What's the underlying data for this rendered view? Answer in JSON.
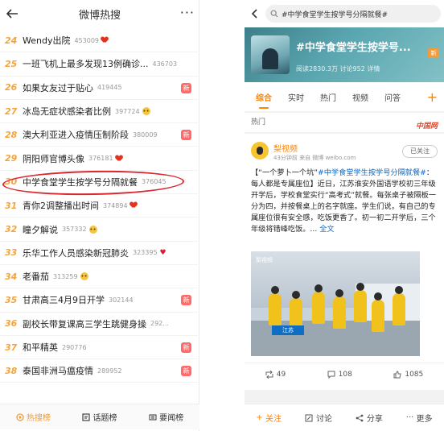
{
  "left": {
    "title": "微博热搜",
    "more_label": "···",
    "rows": [
      {
        "rank": "24",
        "text": "Wendy出院",
        "count": "453009",
        "mark": "heart",
        "badge": ""
      },
      {
        "rank": "25",
        "text": "一班飞机上最多发现13例确诊...",
        "count": "436703",
        "mark": "",
        "badge": ""
      },
      {
        "rank": "26",
        "text": "如果女友过于贴心",
        "count": "419445",
        "mark": "",
        "badge": "新"
      },
      {
        "rank": "27",
        "text": "冰岛无症状感染者比例",
        "count": "397724",
        "mark": "emoji",
        "badge": ""
      },
      {
        "rank": "28",
        "text": "澳大利亚进入疫情压制阶段",
        "count": "380009",
        "mark": "",
        "badge": "新"
      },
      {
        "rank": "29",
        "text": "阴阳师官博头像",
        "count": "376181",
        "mark": "heart",
        "badge": ""
      },
      {
        "rank": "30",
        "text": "中学食堂学生按学号分隔就餐",
        "count": "376045",
        "mark": "",
        "badge": ""
      },
      {
        "rank": "31",
        "text": "青你2调整播出时间",
        "count": "374894",
        "mark": "heart",
        "badge": ""
      },
      {
        "rank": "32",
        "text": "瞳夕解说",
        "count": "357332",
        "mark": "emoji",
        "badge": ""
      },
      {
        "rank": "33",
        "text": "乐华工作人员感染新冠肺炎",
        "count": "323395",
        "mark": "broken",
        "badge": ""
      },
      {
        "rank": "34",
        "text": "老番茄",
        "count": "313259",
        "mark": "emoji",
        "badge": ""
      },
      {
        "rank": "35",
        "text": "甘肃高三4月9日开学",
        "count": "302144",
        "mark": "",
        "badge": "新"
      },
      {
        "rank": "36",
        "text": "副校长带复课高三学生跳健身操",
        "count": "292...",
        "mark": "",
        "badge": ""
      },
      {
        "rank": "37",
        "text": "和平精英",
        "count": "290776",
        "mark": "",
        "badge": "新"
      },
      {
        "rank": "38",
        "text": "泰国非洲马瘟疫情",
        "count": "289952",
        "mark": "",
        "badge": "新"
      }
    ],
    "tabs": [
      {
        "label": "热搜榜"
      },
      {
        "label": "话题榜"
      },
      {
        "label": "要闻榜"
      }
    ]
  },
  "right": {
    "search_text": "#中学食堂学生按学号分隔就餐#",
    "topic_title": "#中学食堂学生按学号...",
    "topic_stats": "阅读2830.3万  讨论952  详情",
    "topic_tag": "新",
    "tabs": [
      "综合",
      "实时",
      "热门",
      "视频",
      "问答"
    ],
    "tab_plus": "+",
    "section_label": "热门",
    "section_logo": "中国网",
    "post": {
      "author": "梨视频",
      "meta": "43分钟前  来自 微博 weibo.com",
      "follow_label": "已关注",
      "text_a": "【“一个萝卜一个坑”",
      "hashtag": "#中学食堂学生按学号分隔就餐#",
      "text_b": "：每人都是专属座位",
      "text_c": "】近日，江苏淮安外国语学校初三年级开学后，学校食堂实行“高考式”就餐。每张桌子被隔板一分为四，并按餐桌上的名字就座。学生们说，有自己的专属座位很有安全感，吃饭更香了。初一初二开学后，三个年级将错峰吃饭。...",
      "more": "全文",
      "photo_logo": "梨视频",
      "photo_label": "江苏",
      "repost_count": "49",
      "comment_count": "108",
      "like_count": "1085"
    },
    "bottom": [
      {
        "label": "关注"
      },
      {
        "label": "讨论"
      },
      {
        "label": "分享"
      },
      {
        "label": "更多"
      }
    ]
  },
  "colors": {
    "rank": "#f7a33a",
    "accent": "#ff8200",
    "link": "#0a65c4",
    "circle": "#d9282f"
  }
}
